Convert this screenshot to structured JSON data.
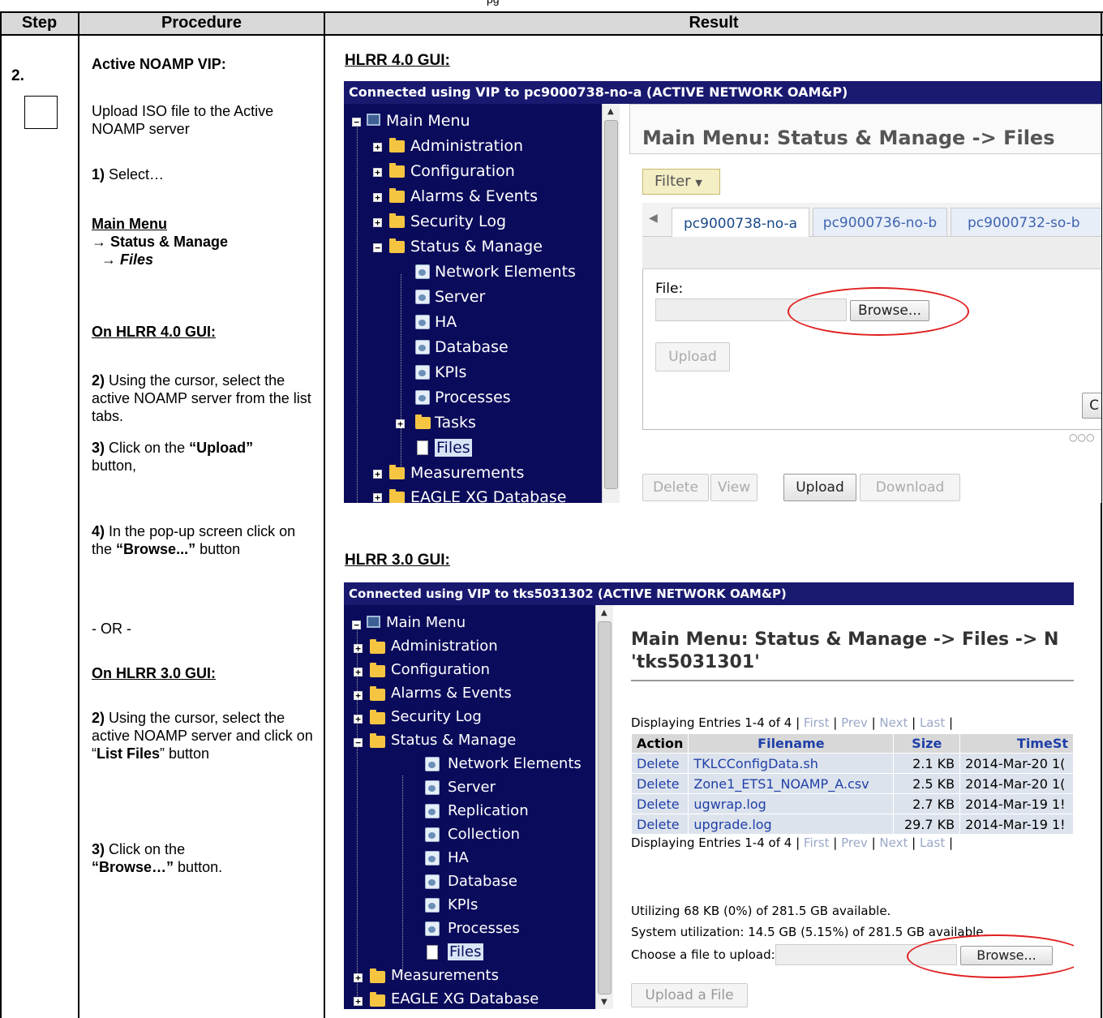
{
  "top_partial": "pg",
  "header": {
    "step": "Step",
    "procedure": "Procedure",
    "result": "Result"
  },
  "step": {
    "number": "2."
  },
  "procedure": {
    "title": "Active NOAMP VIP:",
    "intro": "Upload ISO file to the Active NOAMP server",
    "s1_num": "1)",
    "s1_text": "Select…",
    "menu_main": "Main Menu",
    "menu_status": "→ Status & Manage",
    "menu_files": "→ Files",
    "hlrr40_heading": "On HLRR 4.0 GUI:",
    "s2_num": "2)",
    "s2_text": "Using the cursor, select the active NOAMP server from the list tabs.",
    "s3_num": "3)",
    "s3_pre": "Click on the",
    "s3_bold": "“Upload”",
    "s3_post": "button,",
    "s4_num": "4)",
    "s4_pre": "In the pop-up screen click on the",
    "s4_bold": "“Browse...”",
    "s4_post": "button",
    "or": "- OR -",
    "hlrr30_heading": "On HLRR 3.0 GUI:",
    "b2_num": "2)",
    "b2_pre": "Using the cursor, select the active NOAMP server and click on “",
    "b2_bold": "List Files",
    "b2_post": "” button",
    "b3_num": "3)",
    "b3_pre": "Click on the",
    "b3_bold": "“Browse…”",
    "b3_post": "button."
  },
  "result": {
    "hlrr40_title": "HLRR 4.0 GUI:",
    "hlrr30_title": "HLRR 3.0 GUI:"
  },
  "shot40": {
    "bar": "Connected using VIP to pc9000738-no-a (ACTIVE NETWORK OAM&P)",
    "tree": [
      "Main Menu",
      "Administration",
      "Configuration",
      "Alarms & Events",
      "Security Log",
      "Status & Manage",
      "Network Elements",
      "Server",
      "HA",
      "Database",
      "KPIs",
      "Processes",
      "Tasks",
      "Files",
      "Measurements",
      "EAGLE XG Database"
    ],
    "page_title": "Main Menu: Status & Manage -> Files",
    "filter": "Filter",
    "tabs": [
      "pc9000738-no-a",
      "pc9000736-no-b",
      "pc9000732-so-b"
    ],
    "file_label": "File:",
    "browse": "Browse...",
    "upload_dialog_btn": "Upload",
    "cut_btn": "C",
    "bottom_buttons": [
      "Delete",
      "View",
      "Upload",
      "Download"
    ]
  },
  "shot30": {
    "bar": "Connected using VIP to tks5031302 (ACTIVE NETWORK OAM&P)",
    "tree": [
      "Main Menu",
      "Administration",
      "Configuration",
      "Alarms & Events",
      "Security Log",
      "Status & Manage",
      "Network Elements",
      "Server",
      "Replication",
      "Collection",
      "HA",
      "Database",
      "KPIs",
      "Processes",
      "Files",
      "Measurements",
      "EAGLE XG Database"
    ],
    "page_title_1": "Main Menu: Status & Manage -> Files -> N",
    "page_title_2": "'tks5031301'",
    "display_entries": "Displaying Entries 1-4 of 4",
    "nav": [
      "First",
      "Prev",
      "Next",
      "Last"
    ],
    "columns": [
      "Action",
      "Filename",
      "Size",
      "TimeSt"
    ],
    "rows": [
      [
        "Delete",
        "TKLCConfigData.sh",
        "2.1 KB",
        "2014-Mar-20 1("
      ],
      [
        "Delete",
        "Zone1_ETS1_NOAMP_A.csv",
        "2.5 KB",
        "2014-Mar-20 1("
      ],
      [
        "Delete",
        "ugwrap.log",
        "2.7 KB",
        "2014-Mar-19 1!"
      ],
      [
        "Delete",
        "upgrade.log",
        "29.7 KB",
        "2014-Mar-19 1!"
      ]
    ],
    "utilizing": "Utilizing 68 KB (0%) of 281.5 GB available.",
    "system_util": "System utilization: 14.5 GB (5.15%) of 281.5 GB available.",
    "choose": "Choose a file to upload:",
    "browse": "Browse...",
    "upload_btn": "Upload a File"
  },
  "colors": {
    "header_bg": "#d9d9d9",
    "bar_bg": "#191970",
    "tree_bg": "#0b0b5c",
    "ellipse": "#e02020"
  }
}
